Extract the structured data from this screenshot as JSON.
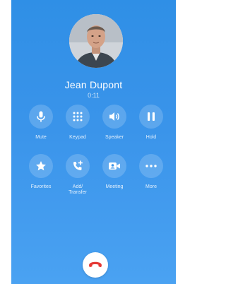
{
  "call": {
    "caller_name": "Jean Dupont",
    "duration": "0:11"
  },
  "controls_row1": [
    {
      "label": "Mute",
      "icon": "microphone-icon"
    },
    {
      "label": "Keypad",
      "icon": "keypad-icon"
    },
    {
      "label": "Speaker",
      "icon": "speaker-icon"
    },
    {
      "label": "Hold",
      "icon": "pause-icon"
    }
  ],
  "controls_row2": [
    {
      "label": "Favorites",
      "icon": "star-icon"
    },
    {
      "label": "Add/\nTransfer",
      "icon": "phone-add-icon"
    },
    {
      "label": "Meeting",
      "icon": "video-camera-icon"
    },
    {
      "label": "More",
      "icon": "more-dots-icon"
    }
  ],
  "end_call": {
    "icon": "hang-up-icon",
    "color": "#e53935"
  },
  "colors": {
    "background": "#3a94ea",
    "button_fill": "rgba(255,255,255,0.18)",
    "end_call_bg": "#ffffff"
  }
}
